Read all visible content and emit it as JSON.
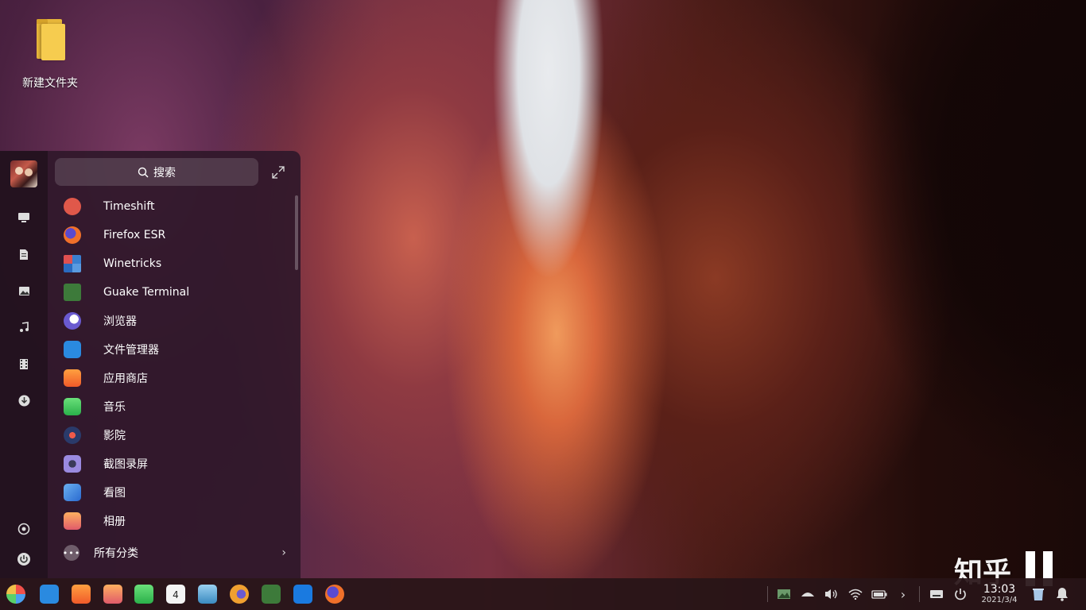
{
  "desktop": {
    "folder_label": "新建文件夹"
  },
  "launcher": {
    "search_placeholder": "搜索",
    "apps": [
      {
        "label": "Timeshift",
        "icon": "timeshift-icon",
        "color": "#e0584a"
      },
      {
        "label": "Firefox ESR",
        "icon": "firefox-icon",
        "color": "#f0702a"
      },
      {
        "label": "Winetricks",
        "icon": "winetricks-icon",
        "color": "#3a7fd0"
      },
      {
        "label": "Guake Terminal",
        "icon": "guake-terminal-icon",
        "color": "#3d7a3a"
      },
      {
        "label": "浏览器",
        "icon": "browser-icon",
        "color": "#6a5ad0"
      },
      {
        "label": "文件管理器",
        "icon": "file-manager-icon",
        "color": "#2a8ae0"
      },
      {
        "label": "应用商店",
        "icon": "app-store-icon",
        "color": "#f57a2a"
      },
      {
        "label": "音乐",
        "icon": "music-icon",
        "color": "#3ac45a"
      },
      {
        "label": "影院",
        "icon": "movie-icon",
        "color": "#2a2a3a"
      },
      {
        "label": "截图录屏",
        "icon": "screenshot-icon",
        "color": "#7a6ad0"
      },
      {
        "label": "看图",
        "icon": "image-viewer-icon",
        "color": "#3a8ae0"
      },
      {
        "label": "相册",
        "icon": "album-icon",
        "color": "#f0884a"
      }
    ],
    "all_categories_label": "所有分类",
    "sidebar": [
      "computer-icon",
      "documents-icon",
      "pictures-icon",
      "music-icon",
      "videos-icon",
      "downloads-icon",
      "settings-icon",
      "power-icon"
    ]
  },
  "taskbar": {
    "time": "13:03",
    "date": "2021/3/4",
    "calendar_day": "4"
  },
  "watermark": {
    "text": "知乎"
  }
}
